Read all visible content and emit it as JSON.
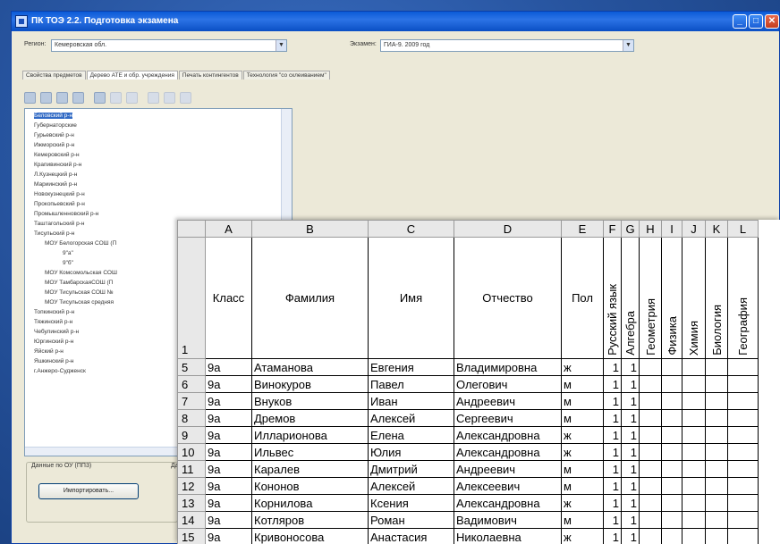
{
  "window": {
    "title": "ПК ТОЭ 2.2. Подготовка экзамена",
    "controls": {
      "minimize": "_",
      "maximize": "□",
      "close": "✕"
    }
  },
  "filters": {
    "region_label": "Регион:",
    "region_value": "Кемеровская обл.",
    "exam_label": "Экзамен:",
    "exam_value": "ГИА-9. 2009 год"
  },
  "tabs": [
    {
      "label": "Свойства предметов",
      "active": false
    },
    {
      "label": "Дерево АТЕ и обр. учреждения",
      "active": true
    },
    {
      "label": "Печать контингентов",
      "active": false
    },
    {
      "label": "Технология \"со склеиванием\"",
      "active": false
    }
  ],
  "tree": {
    "nodes": [
      {
        "label": "Беловский р-н",
        "selected": true
      },
      {
        "label": "Гурьевский р-н"
      },
      {
        "label": "Губернаторские"
      },
      {
        "label": "Ижморский р-н"
      },
      {
        "label": "Кемеровский р-н"
      },
      {
        "label": "Крапивинский р-н"
      },
      {
        "label": "Л.Кузнецкий р-н"
      },
      {
        "label": "Мариинский р-н"
      },
      {
        "label": "Новокузнецкий р-н"
      },
      {
        "label": "Прокопьевский р-н"
      },
      {
        "label": "Промышленновский р-н"
      },
      {
        "label": "Таштагольский р-н"
      },
      {
        "label": "Тисульский р-н"
      },
      {
        "label": "МОУ Белогорская СОШ (П"
      },
      {
        "label": "9\"а\""
      },
      {
        "label": "9\"б\""
      },
      {
        "label": "МОУ Комсомольская СОШ"
      },
      {
        "label": "МОУ ТамбарскаяСОШ (П"
      },
      {
        "label": "МОУ Тисульская СОШ №"
      },
      {
        "label": "МОУ Тисульская средняя"
      },
      {
        "label": "Топкинский р-н"
      },
      {
        "label": "Тяжинский р-н"
      },
      {
        "label": "Чебулинский р-н"
      },
      {
        "label": "Юргинский р-н"
      },
      {
        "label": "Яйский р-н"
      },
      {
        "label": "Яшкинский р-н"
      },
      {
        "label": "г.Анжеро-Судженск"
      }
    ]
  },
  "bottom": {
    "group_title": "Данные по ОУ (ПП3)",
    "group_title_2": "Да",
    "import_button": "Импортировать..."
  },
  "sheet": {
    "columns": [
      "A",
      "B",
      "C",
      "D",
      "E",
      "F",
      "G",
      "H",
      "I",
      "J",
      "K",
      "L"
    ],
    "header_row_number": "1",
    "headers": {
      "A": "Класс",
      "B": "Фамилия",
      "C": "Имя",
      "D": "Отчество",
      "E": "Пол",
      "F": "Русский язык",
      "G": "Алгебра",
      "H": "Геометрия",
      "I": "Физика",
      "J": "Химия",
      "K": "Биология",
      "L": "География"
    },
    "rows": [
      {
        "n": "5",
        "cls": "9а",
        "last": "Атаманова",
        "first": "Евгения",
        "middle": "Владимировна",
        "sex": "ж",
        "f": "1",
        "g": "1"
      },
      {
        "n": "6",
        "cls": "9а",
        "last": "Винокуров",
        "first": "Павел",
        "middle": "Олегович",
        "sex": "м",
        "f": "1",
        "g": "1"
      },
      {
        "n": "7",
        "cls": "9а",
        "last": "Внуков",
        "first": "Иван",
        "middle": "Андреевич",
        "sex": "м",
        "f": "1",
        "g": "1"
      },
      {
        "n": "8",
        "cls": "9а",
        "last": "Дремов",
        "first": "Алексей",
        "middle": "Сергеевич",
        "sex": "м",
        "f": "1",
        "g": "1"
      },
      {
        "n": "9",
        "cls": "9а",
        "last": "Илларионова",
        "first": "Елена",
        "middle": "Александровна",
        "sex": "ж",
        "f": "1",
        "g": "1"
      },
      {
        "n": "10",
        "cls": "9а",
        "last": "Ильвес",
        "first": "Юлия",
        "middle": "Александровна",
        "sex": "ж",
        "f": "1",
        "g": "1"
      },
      {
        "n": "11",
        "cls": "9а",
        "last": "Каралев",
        "first": "Дмитрий",
        "middle": "Андреевич",
        "sex": "м",
        "f": "1",
        "g": "1"
      },
      {
        "n": "12",
        "cls": "9а",
        "last": "Кононов",
        "first": "Алексей",
        "middle": "Алексеевич",
        "sex": "м",
        "f": "1",
        "g": "1"
      },
      {
        "n": "13",
        "cls": "9а",
        "last": "Корнилова",
        "first": "Ксения",
        "middle": "Александровна",
        "sex": "ж",
        "f": "1",
        "g": "1"
      },
      {
        "n": "14",
        "cls": "9а",
        "last": "Котляров",
        "first": "Роман",
        "middle": "Вадимович",
        "sex": "м",
        "f": "1",
        "g": "1"
      },
      {
        "n": "15",
        "cls": "9а",
        "last": "Кривоносова",
        "first": "Анастасия",
        "middle": "Николаевна",
        "sex": "ж",
        "f": "1",
        "g": "1"
      }
    ]
  }
}
